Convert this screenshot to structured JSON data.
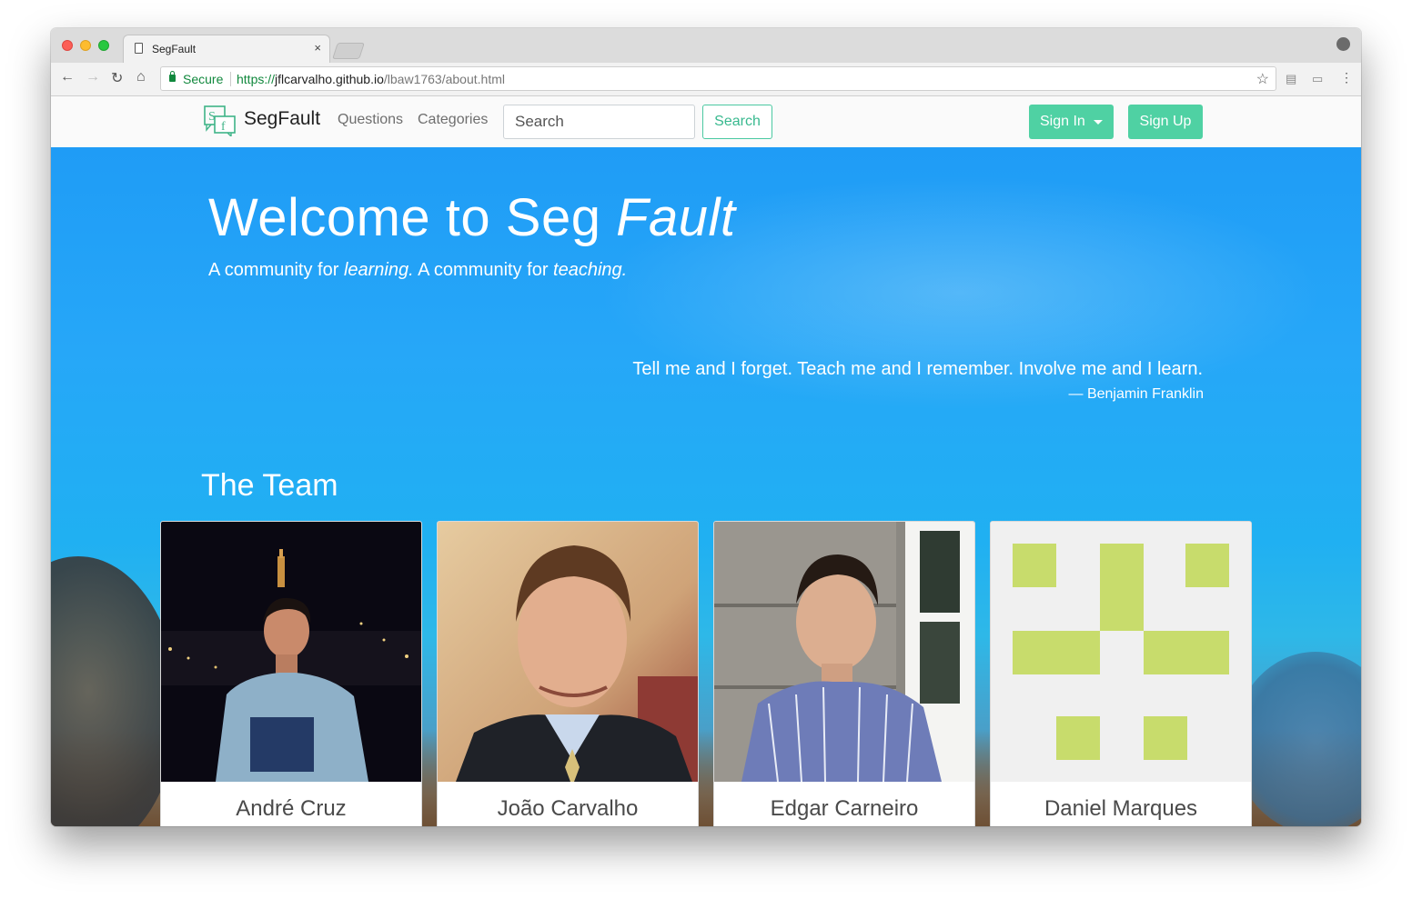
{
  "browser": {
    "tab_title": "SegFault",
    "tab_close": "×",
    "secure_label": "Secure",
    "url_scheme": "https://",
    "url_host": "jflcarvalho.github.io",
    "url_path": "/lbaw1763/about.html"
  },
  "navbar": {
    "brand": "SegFault",
    "links": [
      "Questions",
      "Categories"
    ],
    "search_placeholder": "Search",
    "search_button": "Search",
    "sign_in": "Sign In",
    "sign_up": "Sign Up",
    "accent_color": "#4fd1a3"
  },
  "hero": {
    "title_plain": "Welcome to Seg ",
    "title_italic": "Fault",
    "subtitle_1": "A community for ",
    "subtitle_em_1": "learning.",
    "subtitle_2": " A community for ",
    "subtitle_em_2": "teaching.",
    "quote": "Tell me and I forget. Teach me and I remember. Involve me and I learn.",
    "quote_author": "— Benjamin Franklin"
  },
  "team": {
    "title": "The Team",
    "members": [
      {
        "name": "André Cruz"
      },
      {
        "name": "João Carvalho"
      },
      {
        "name": "Edgar Carneiro"
      },
      {
        "name": "Daniel Marques"
      }
    ]
  }
}
